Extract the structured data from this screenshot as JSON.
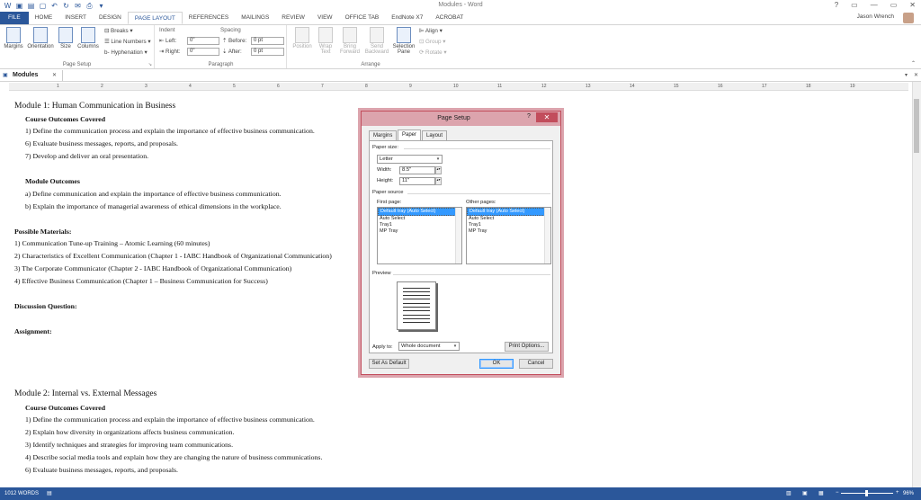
{
  "window": {
    "title": "Modules - Word",
    "help": "?",
    "min": "—",
    "max": "▭",
    "close": "✕"
  },
  "tabs": [
    "FILE",
    "HOME",
    "INSERT",
    "DESIGN",
    "PAGE LAYOUT",
    "REFERENCES",
    "MAILINGS",
    "REVIEW",
    "VIEW",
    "OFFICE TAB",
    "EndNote X7",
    "ACROBAT"
  ],
  "user": "Jason Wrench",
  "ribbon": {
    "page_setup": {
      "label": "Page Setup",
      "margins": "Margins",
      "orientation": "Orientation",
      "size": "Size",
      "columns": "Columns",
      "breaks": "Breaks",
      "line_numbers": "Line Numbers",
      "hyphenation": "Hyphenation"
    },
    "paragraph": {
      "label": "Paragraph",
      "indent": "Indent",
      "spacing": "Spacing",
      "left_label": "Left:",
      "left_value": "0\"",
      "right_label": "Right:",
      "right_value": "0\"",
      "before_label": "Before:",
      "before_value": "0 pt",
      "after_label": "After:",
      "after_value": "0 pt"
    },
    "arrange": {
      "label": "Arrange",
      "position": "Position",
      "wrap_text": "Wrap Text",
      "bring_forward": "Bring Forward",
      "send_backward": "Send Backward",
      "selection_pane": "Selection Pane",
      "align": "Align",
      "group": "Group",
      "rotate": "Rotate"
    }
  },
  "doc_tab": "Modules",
  "ruler_ticks": [
    "1",
    "2",
    "3",
    "4",
    "5",
    "6",
    "7",
    "8",
    "9",
    "10",
    "11",
    "12",
    "13",
    "14",
    "15",
    "16",
    "17",
    "18",
    "19"
  ],
  "document": [
    {
      "text": "Module 1: Human Communication in Business",
      "style": "h1"
    },
    {
      "text": "Course Outcomes Covered",
      "style": "b ind"
    },
    {
      "text": "1) Define the communication process and explain the importance of effective business communication.",
      "style": "ind"
    },
    {
      "text": "6) Evaluate business messages, reports, and proposals.",
      "style": "ind"
    },
    {
      "text": "7) Develop and deliver an oral presentation.",
      "style": "ind"
    },
    {
      "text": "Module Outcomes",
      "style": "b ind"
    },
    {
      "text": "a) Define communication and explain the importance of effective business communication.",
      "style": "ind"
    },
    {
      "text": "b) Explain the importance of managerial awareness of ethical dimensions in the workplace.",
      "style": "ind"
    },
    {
      "text": "Possible Materials:",
      "style": "b"
    },
    {
      "text": "1) Communication Tune-up Training – Atomic Learning (60 minutes)",
      "style": ""
    },
    {
      "text": "2) Characteristics of Excellent Communication (Chapter 1 - IABC Handbook of Organizational Communication)",
      "style": ""
    },
    {
      "text": "3) The Corporate Communicator (Chapter 2 - IABC Handbook of Organizational Communication)",
      "style": ""
    },
    {
      "text": "4) Effective Business Communication (Chapter 1 – Business Communication for Success)",
      "style": ""
    },
    {
      "text": "Discussion Question:",
      "style": "b"
    },
    {
      "text": "Assignment:",
      "style": "b"
    },
    {
      "text": "Module 2: Internal vs. External Messages",
      "style": "h1"
    },
    {
      "text": "Course Outcomes Covered",
      "style": "b ind"
    },
    {
      "text": "1) Define the communication process and explain the importance of effective business communication.",
      "style": "ind"
    },
    {
      "text": "2) Explain how diversity in organizations affects business communication.",
      "style": "ind"
    },
    {
      "text": "3) Identify techniques and strategies for improving team communications.",
      "style": "ind"
    },
    {
      "text": "4) Describe social media tools and explain how they are changing the nature of business communications.",
      "style": "ind"
    },
    {
      "text": "6) Evaluate business messages, reports, and proposals.",
      "style": "ind"
    }
  ],
  "dialog": {
    "title": "Page Setup",
    "help": "?",
    "close": "✕",
    "tabs": [
      "Margins",
      "Paper",
      "Layout"
    ],
    "active_tab": "Paper",
    "paper_size_label": "Paper size:",
    "paper_size": "Letter",
    "width_label": "Width:",
    "width": "8.5\"",
    "height_label": "Height:",
    "height": "11\"",
    "paper_source_label": "Paper source",
    "first_page_label": "First page:",
    "other_pages_label": "Other pages:",
    "first_page_items": [
      "Default tray (Auto Select)",
      "Auto Select",
      "Tray1",
      "MP Tray"
    ],
    "other_pages_items": [
      "Default tray (Auto Select)",
      "Auto Select",
      "Tray1",
      "MP Tray"
    ],
    "preview_label": "Preview",
    "apply_to_label": "Apply to:",
    "apply_to": "Whole document",
    "print_options": "Print Options...",
    "set_default": "Set As Default",
    "ok": "OK",
    "cancel": "Cancel"
  },
  "status": {
    "words": "1012 WORDS",
    "zoom": "96%"
  }
}
